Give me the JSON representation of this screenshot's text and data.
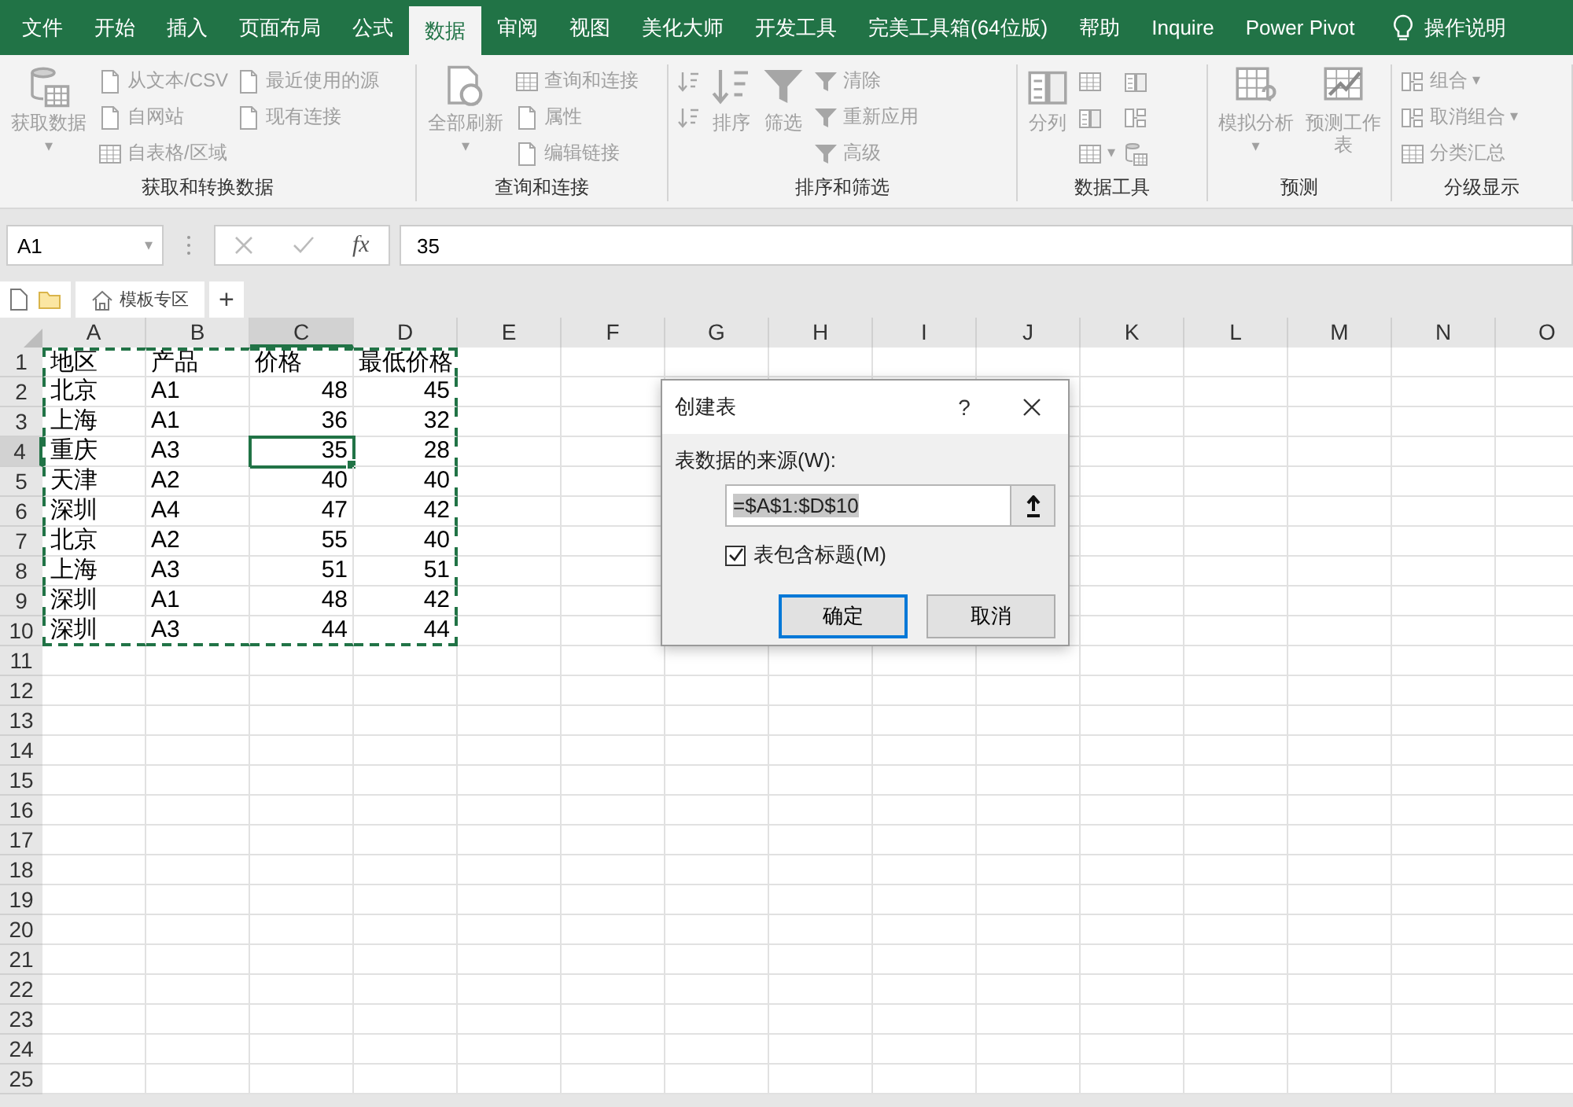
{
  "menu_tabs": [
    {
      "label": "文件",
      "selected": false
    },
    {
      "label": "开始",
      "selected": false
    },
    {
      "label": "插入",
      "selected": false
    },
    {
      "label": "页面布局",
      "selected": false
    },
    {
      "label": "公式",
      "selected": false
    },
    {
      "label": "数据",
      "selected": true
    },
    {
      "label": "审阅",
      "selected": false
    },
    {
      "label": "视图",
      "selected": false
    },
    {
      "label": "美化大师",
      "selected": false
    },
    {
      "label": "开发工具",
      "selected": false
    },
    {
      "label": "完美工具箱(64位版)",
      "selected": false
    },
    {
      "label": "帮助",
      "selected": false
    },
    {
      "label": "Inquire",
      "selected": false
    },
    {
      "label": "Power Pivot",
      "selected": false
    }
  ],
  "tell_me": {
    "label": "操作说明"
  },
  "ribbon_groups": [
    {
      "label": "获取和转换数据",
      "columns": [
        {
          "kind": "large",
          "items": [
            {
              "label": "获取数据",
              "kind": "database",
              "caret": "▾"
            }
          ]
        },
        {
          "kind": "stack",
          "items": [
            {
              "label": "从文本/CSV",
              "kind": "document"
            },
            {
              "label": "自网站",
              "kind": "document"
            },
            {
              "label": "自表格/区域",
              "kind": "table"
            }
          ]
        },
        {
          "kind": "stack",
          "items": [
            {
              "label": "最近使用的源",
              "kind": "document"
            },
            {
              "label": "现有连接",
              "kind": "document"
            }
          ]
        }
      ]
    },
    {
      "label": "查询和连接",
      "columns": [
        {
          "kind": "large",
          "items": [
            {
              "label": "全部刷新",
              "kind": "refresh",
              "caret": "▾"
            }
          ]
        },
        {
          "kind": "stack",
          "items": [
            {
              "label": "查询和连接",
              "kind": "table"
            },
            {
              "label": "属性",
              "kind": "document"
            },
            {
              "label": "编辑链接",
              "kind": "document"
            }
          ]
        }
      ]
    },
    {
      "label": "排序和筛选",
      "columns": [
        {
          "kind": "stack",
          "items": [
            {
              "kind": "sort"
            },
            {
              "kind": "sort"
            }
          ]
        },
        {
          "kind": "large",
          "items": [
            {
              "label": "排序",
              "kind": "sort"
            }
          ]
        },
        {
          "kind": "large",
          "items": [
            {
              "label": "筛选",
              "kind": "funnel"
            }
          ]
        },
        {
          "kind": "stack",
          "items": [
            {
              "label": "清除",
              "kind": "funnel"
            },
            {
              "label": "重新应用",
              "kind": "funnel"
            },
            {
              "label": "高级",
              "kind": "funnel"
            }
          ]
        }
      ]
    },
    {
      "label": "数据工具",
      "columns": [
        {
          "kind": "large",
          "items": [
            {
              "label": "分列",
              "kind": "columns"
            }
          ]
        },
        {
          "kind": "stack",
          "items": [
            {
              "kind": "table"
            },
            {
              "kind": "columns"
            },
            {
              "kind": "table",
              "caret": "▾"
            }
          ]
        },
        {
          "kind": "stack",
          "items": [
            {
              "kind": "columns"
            },
            {
              "kind": "group"
            },
            {
              "kind": "database"
            }
          ]
        }
      ]
    },
    {
      "label": "预测",
      "columns": [
        {
          "kind": "large",
          "items": [
            {
              "label": "模拟分析",
              "kind": "grid",
              "caret": "▾"
            }
          ]
        },
        {
          "kind": "large",
          "items": [
            {
              "label": "预测工作表",
              "kind": "chart"
            }
          ]
        }
      ]
    },
    {
      "label": "分级显示",
      "columns": [
        {
          "kind": "stack",
          "items": [
            {
              "label": "组合",
              "kind": "group",
              "caret": "▾"
            },
            {
              "label": "取消组合",
              "kind": "group",
              "caret": "▾"
            },
            {
              "label": "分类汇总",
              "kind": "table"
            }
          ]
        }
      ]
    }
  ],
  "name_box": {
    "value": "A1",
    "caret": "▾"
  },
  "formula_bar": {
    "fx": "fx",
    "value": "35"
  },
  "sheet_bar": {
    "tab": "模板专区",
    "add": "+"
  },
  "columns": [
    {
      "label": "A",
      "selected": false
    },
    {
      "label": "B",
      "selected": false
    },
    {
      "label": "C",
      "selected": true
    },
    {
      "label": "D",
      "selected": false
    },
    {
      "label": "E",
      "selected": false
    },
    {
      "label": "F",
      "selected": false
    },
    {
      "label": "G",
      "selected": false
    },
    {
      "label": "H",
      "selected": false
    },
    {
      "label": "I",
      "selected": false
    },
    {
      "label": "J",
      "selected": false
    },
    {
      "label": "K",
      "selected": false
    },
    {
      "label": "L",
      "selected": false
    },
    {
      "label": "M",
      "selected": false
    },
    {
      "label": "N",
      "selected": false
    },
    {
      "label": "O",
      "selected": false
    }
  ],
  "rows": [
    {
      "header": "1",
      "selected": false,
      "cells": [
        {
          "text": "地区",
          "kind": "text",
          "marked": true
        },
        {
          "text": "产品",
          "kind": "text",
          "marked": true
        },
        {
          "text": "价格",
          "kind": "text",
          "marked": true
        },
        {
          "text": "最低价格",
          "kind": "text",
          "marked": true
        }
      ]
    },
    {
      "header": "2",
      "selected": false,
      "cells": [
        {
          "text": "北京",
          "kind": "text",
          "marked": true
        },
        {
          "text": "A1",
          "kind": "text",
          "marked": true
        },
        {
          "text": "48",
          "kind": "number",
          "marked": true
        },
        {
          "text": "45",
          "kind": "number",
          "marked": true
        }
      ]
    },
    {
      "header": "3",
      "selected": false,
      "cells": [
        {
          "text": "上海",
          "kind": "text",
          "marked": true
        },
        {
          "text": "A1",
          "kind": "text",
          "marked": true
        },
        {
          "text": "36",
          "kind": "number",
          "marked": true
        },
        {
          "text": "32",
          "kind": "number",
          "marked": true
        }
      ]
    },
    {
      "header": "4",
      "selected": true,
      "cells": [
        {
          "text": "重庆",
          "kind": "text",
          "marked": true
        },
        {
          "text": "A3",
          "kind": "text",
          "marked": true
        },
        {
          "text": "35",
          "kind": "number",
          "marked": true
        },
        {
          "text": "28",
          "kind": "number",
          "marked": true
        }
      ]
    },
    {
      "header": "5",
      "selected": false,
      "cells": [
        {
          "text": "天津",
          "kind": "text",
          "marked": true
        },
        {
          "text": "A2",
          "kind": "text",
          "marked": true
        },
        {
          "text": "40",
          "kind": "number",
          "marked": true
        },
        {
          "text": "40",
          "kind": "number",
          "marked": true
        }
      ]
    },
    {
      "header": "6",
      "selected": false,
      "cells": [
        {
          "text": "深圳",
          "kind": "text",
          "marked": true
        },
        {
          "text": "A4",
          "kind": "text",
          "marked": true
        },
        {
          "text": "47",
          "kind": "number",
          "marked": true
        },
        {
          "text": "42",
          "kind": "number",
          "marked": true
        }
      ]
    },
    {
      "header": "7",
      "selected": false,
      "cells": [
        {
          "text": "北京",
          "kind": "text",
          "marked": true
        },
        {
          "text": "A2",
          "kind": "text",
          "marked": true
        },
        {
          "text": "55",
          "kind": "number",
          "marked": true
        },
        {
          "text": "40",
          "kind": "number",
          "marked": true
        }
      ]
    },
    {
      "header": "8",
      "selected": false,
      "cells": [
        {
          "text": "上海",
          "kind": "text",
          "marked": true
        },
        {
          "text": "A3",
          "kind": "text",
          "marked": true
        },
        {
          "text": "51",
          "kind": "number",
          "marked": true
        },
        {
          "text": "51",
          "kind": "number",
          "marked": true
        }
      ]
    },
    {
      "header": "9",
      "selected": false,
      "cells": [
        {
          "text": "深圳",
          "kind": "text",
          "marked": true
        },
        {
          "text": "A1",
          "kind": "text",
          "marked": true
        },
        {
          "text": "48",
          "kind": "number",
          "marked": true
        },
        {
          "text": "42",
          "kind": "number",
          "marked": true
        }
      ]
    },
    {
      "header": "10",
      "selected": false,
      "cells": [
        {
          "text": "深圳",
          "kind": "text",
          "marked": true
        },
        {
          "text": "A3",
          "kind": "text",
          "marked": true
        },
        {
          "text": "44",
          "kind": "number",
          "marked": true
        },
        {
          "text": "44",
          "kind": "number",
          "marked": true
        }
      ]
    },
    {
      "header": "11",
      "selected": false
    },
    {
      "header": "12",
      "selected": false
    },
    {
      "header": "13",
      "selected": false
    },
    {
      "header": "14",
      "selected": false
    },
    {
      "header": "15",
      "selected": false
    },
    {
      "header": "16",
      "selected": false
    },
    {
      "header": "17",
      "selected": false
    },
    {
      "header": "18",
      "selected": false
    },
    {
      "header": "19",
      "selected": false
    },
    {
      "header": "20",
      "selected": false
    },
    {
      "header": "21",
      "selected": false
    },
    {
      "header": "22",
      "selected": false
    },
    {
      "header": "23",
      "selected": false
    },
    {
      "header": "24",
      "selected": false
    },
    {
      "header": "25",
      "selected": false
    }
  ],
  "dialog": {
    "title": "创建表",
    "help": "?",
    "source_label": "表数据的来源(W):",
    "source_value": "=$A$1:$D$10",
    "value_selected": true,
    "header_checkbox": {
      "label": "表包含标题(M)",
      "checked": true
    },
    "buttons": [
      {
        "label": "确定",
        "default": true
      },
      {
        "label": "取消",
        "default": false
      }
    ]
  }
}
